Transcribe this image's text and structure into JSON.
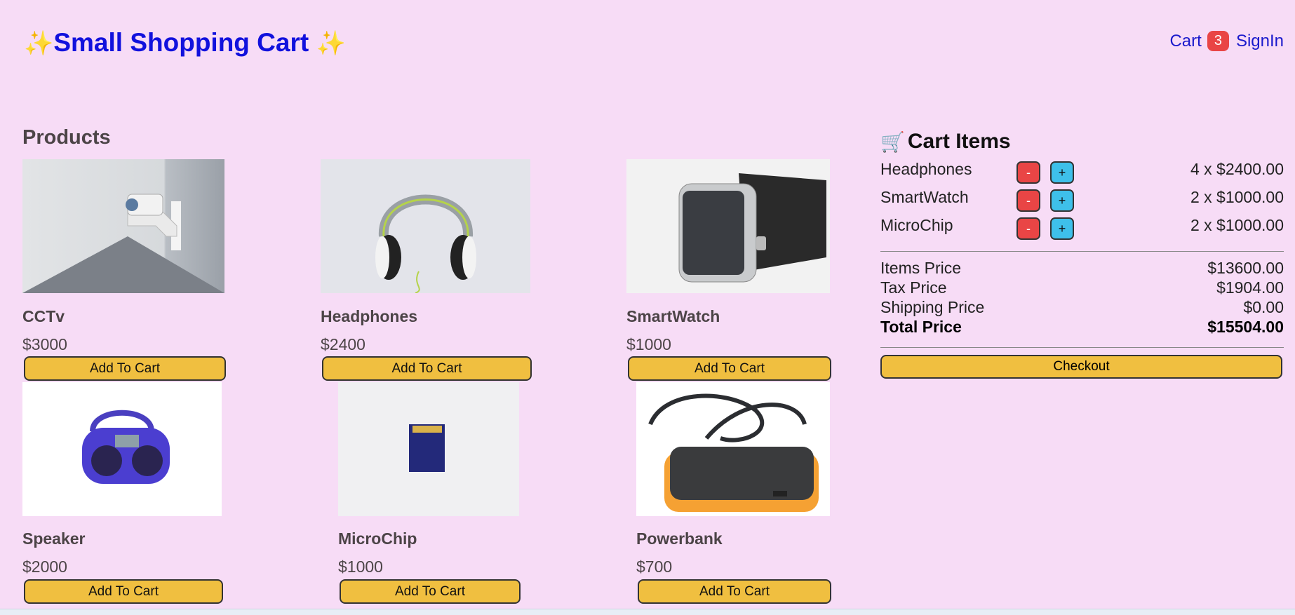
{
  "header": {
    "brand_sparkle_left": "✨",
    "brand_title": "Small Shopping Cart",
    "brand_sparkle_right": "✨",
    "cart_link": "Cart",
    "cart_count": "3",
    "signin_link": "SignIn"
  },
  "products": {
    "title": "Products",
    "items": [
      {
        "name": "CCTv",
        "price": "$3000",
        "button": "Add To Cart"
      },
      {
        "name": "Headphones",
        "price": "$2400",
        "button": "Add To Cart"
      },
      {
        "name": "SmartWatch",
        "price": "$1000",
        "button": "Add To Cart"
      },
      {
        "name": "Speaker",
        "price": "$2000",
        "button": "Add To Cart"
      },
      {
        "name": "MicroChip",
        "price": "$1000",
        "button": "Add To Cart"
      },
      {
        "name": "Powerbank",
        "price": "$700",
        "button": "Add To Cart"
      }
    ]
  },
  "cart": {
    "title_icon": "🛒",
    "title": "Cart Items",
    "items": [
      {
        "name": "Headphones",
        "minus": "-",
        "plus": "+",
        "qty": "4 x $2400.00"
      },
      {
        "name": "SmartWatch",
        "minus": "-",
        "plus": "+",
        "qty": "2 x $1000.00"
      },
      {
        "name": "MicroChip",
        "minus": "-",
        "plus": "+",
        "qty": "2 x $1000.00"
      }
    ],
    "items_price_label": "Items Price",
    "items_price": "$13600.00",
    "tax_price_label": "Tax Price",
    "tax_price": "$1904.00",
    "shipping_price_label": "Shipping Price",
    "shipping_price": "$0.00",
    "total_price_label": "Total Price",
    "total_price": "$15504.00",
    "checkout": "Checkout"
  },
  "colors": {
    "background": "#f7dcf6",
    "brand": "#1111dd",
    "button": "#f0bf40",
    "minus": "#e94545",
    "plus": "#3ec0ea"
  }
}
